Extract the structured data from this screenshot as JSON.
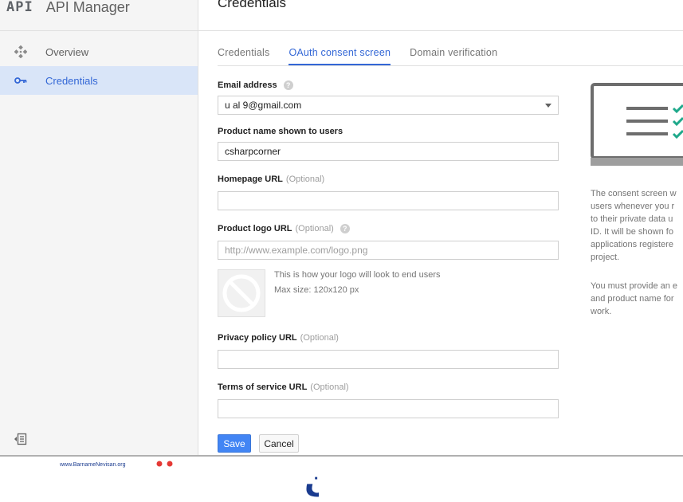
{
  "app": {
    "logo_text": "API",
    "title": "API Manager"
  },
  "sidebar": {
    "items": [
      {
        "label": "Overview",
        "icon": "overview-icon"
      },
      {
        "label": "Credentials",
        "icon": "key-icon",
        "active": true
      }
    ]
  },
  "page": {
    "title": "Credentials"
  },
  "tabs": [
    {
      "label": "Credentials"
    },
    {
      "label": "OAuth consent screen",
      "active": true
    },
    {
      "label": "Domain verification"
    }
  ],
  "form": {
    "email": {
      "label": "Email address",
      "value": "u    al   9@gmail.com"
    },
    "product_name": {
      "label": "Product name shown to users",
      "value": "csharpcorner"
    },
    "homepage": {
      "label": "Homepage URL",
      "optional": "(Optional)",
      "value": ""
    },
    "logo_url": {
      "label": "Product logo URL",
      "optional": "(Optional)",
      "placeholder": "http://www.example.com/logo.png"
    },
    "logo_hint_1": "This is how your logo will look to end users",
    "logo_hint_2": "Max size: 120x120 px",
    "privacy": {
      "label": "Privacy policy URL",
      "optional": "(Optional)",
      "value": ""
    },
    "tos": {
      "label": "Terms of service URL",
      "optional": "(Optional)",
      "value": ""
    },
    "save_label": "Save",
    "cancel_label": "Cancel"
  },
  "info": {
    "p1": [
      "The consent screen w",
      "users whenever you r",
      "to their private data u",
      "ID. It will be shown fo",
      "applications registere",
      "project."
    ],
    "p2": [
      "You must provide an e",
      "and product name for",
      "work."
    ]
  },
  "watermark": {
    "site": "www.BarnameNevisan.org",
    "logo_text": "برنامه نویسان"
  },
  "colors": {
    "accent": "#3367d6",
    "save_button": "#4285f4",
    "active_nav_bg": "#d9e5f8",
    "check_green": "#1fa98b"
  }
}
